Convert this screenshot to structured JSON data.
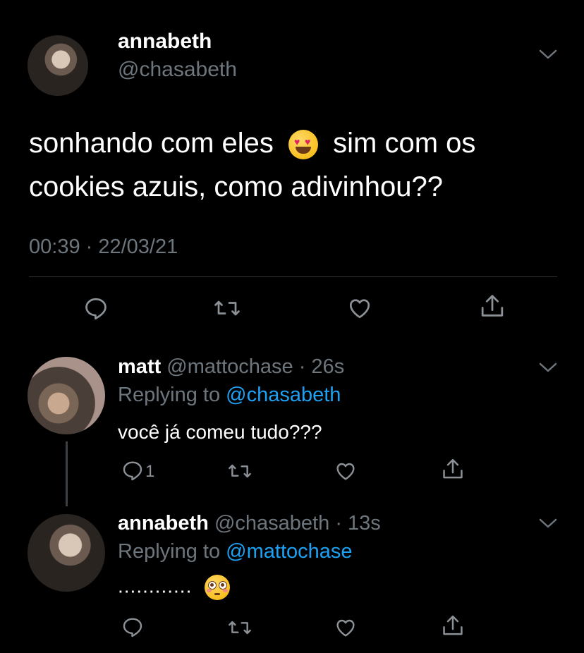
{
  "main_tweet": {
    "name": "annabeth",
    "handle": "@chasabeth",
    "text_part1": "sonhando com eles",
    "text_part2": "sim com os",
    "text_line2": "cookies azuis, como adivinhou??",
    "emoji": "heart-eyes",
    "timestamp": "00:39 · 22/03/21"
  },
  "replies": [
    {
      "name": "matt",
      "handle": "@mattochase",
      "time": "· 26s",
      "replying_prefix": "Replying to",
      "replying_to": "@chasabeth",
      "text": "você já comeu tudo???",
      "reply_count": "1"
    },
    {
      "name": "annabeth",
      "handle": "@chasabeth",
      "time": "· 13s",
      "replying_prefix": "Replying to",
      "replying_to": "@mattochase",
      "text": "............",
      "emoji": "flushed"
    }
  ],
  "colors": {
    "background": "#000000",
    "text": "#ffffff",
    "muted": "#6e767d",
    "link": "#1da1f2",
    "divider": "#2f3336"
  }
}
